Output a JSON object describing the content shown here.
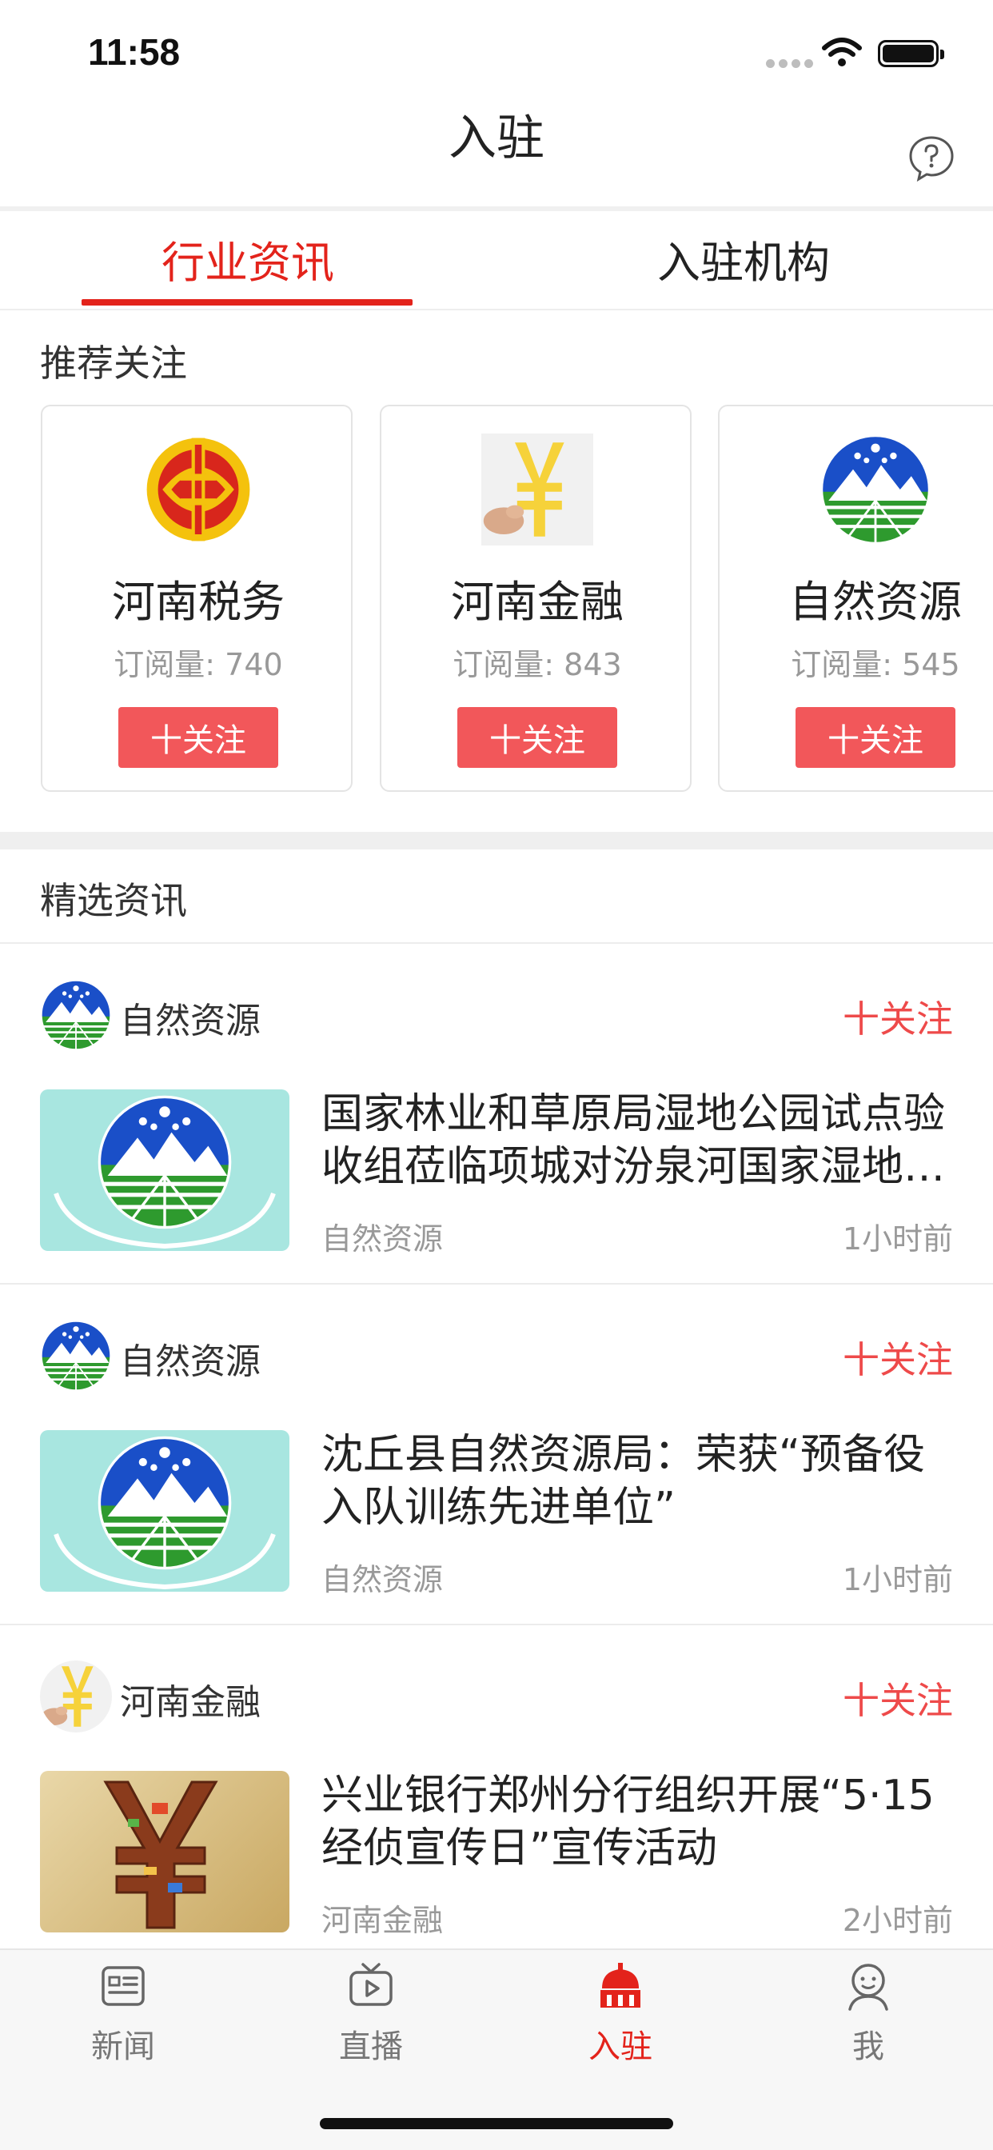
{
  "status_bar": {
    "time": "11:58"
  },
  "header": {
    "title": "入驻"
  },
  "tabs": [
    {
      "label": "行业资讯",
      "active": true
    },
    {
      "label": "入驻机构",
      "active": false
    }
  ],
  "recommend": {
    "title": "推荐关注",
    "cards": [
      {
        "name": "河南税务",
        "subs": "订阅量: 740",
        "follow": "十关注",
        "logo": "tax-emblem-icon"
      },
      {
        "name": "河南金融",
        "subs": "订阅量: 843",
        "follow": "十关注",
        "logo": "yuan-hand-icon"
      },
      {
        "name": "自然资源",
        "subs": "订阅量: 545",
        "follow": "十关注",
        "logo": "natural-resources-emblem-icon"
      }
    ]
  },
  "featured": {
    "title": "精选资讯",
    "items": [
      {
        "source": "自然资源",
        "follow": "十关注",
        "title": "国家林业和草原局湿地公园试点验收组莅临项城对汾泉河国家湿地公园进行验收",
        "category": "自然资源",
        "time": "1小时前"
      },
      {
        "source": "自然资源",
        "follow": "十关注",
        "title": "沈丘县自然资源局：荣获“预备役入队训练先进单位”",
        "category": "自然资源",
        "time": "1小时前"
      },
      {
        "source": "河南金融",
        "follow": "十关注",
        "title": "兴业银行郑州分行组织开展“5·15经侦宣传日”宣传活动",
        "category": "河南金融",
        "time": "2小时前"
      }
    ]
  },
  "tab_bar": [
    {
      "label": "新闻",
      "icon": "news-icon",
      "active": false
    },
    {
      "label": "直播",
      "icon": "tv-icon",
      "active": false
    },
    {
      "label": "入驻",
      "icon": "building-icon",
      "active": true
    },
    {
      "label": "我",
      "icon": "person-icon",
      "active": false
    }
  ],
  "colors": {
    "accent": "#e3231b",
    "follow_button": "#f2575a",
    "follow_text": "#ee4a4a"
  }
}
